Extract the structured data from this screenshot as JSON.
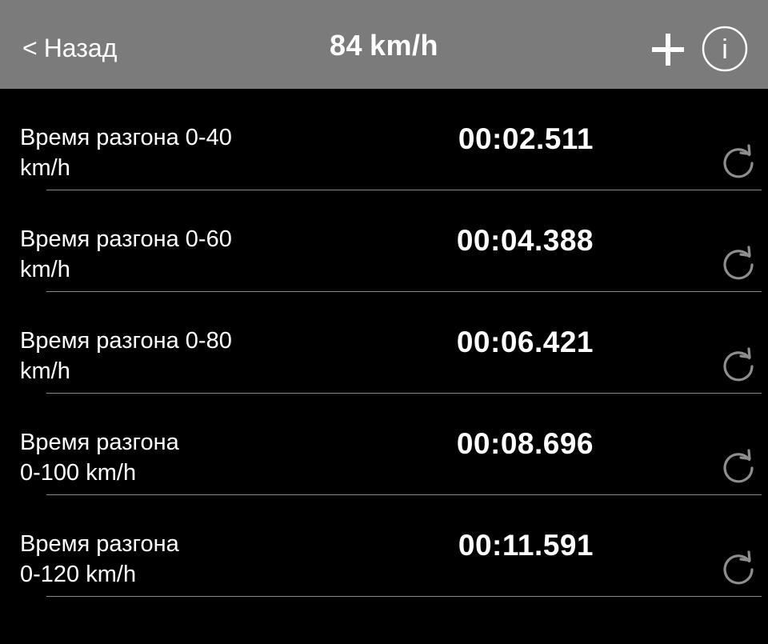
{
  "nav": {
    "back_chevron": "<",
    "back_label": "Назад",
    "title_speed": "84",
    "title_unit": "km/h",
    "add_icon": "plus-icon",
    "info_icon": "info-icon",
    "info_glyph": "i",
    "bar_color": "#7b7b7b"
  },
  "rows": [
    {
      "label": "Время разгона  0-40\nkm/h",
      "time": "00:02.511",
      "icon": "refresh-icon"
    },
    {
      "label": "Время разгона  0-60\nkm/h",
      "time": "00:04.388",
      "icon": "refresh-icon"
    },
    {
      "label": "Время разгона  0-80\nkm/h",
      "time": "00:06.421",
      "icon": "refresh-icon"
    },
    {
      "label": "Время разгона\n0-100 km/h",
      "time": "00:08.696",
      "icon": "refresh-icon"
    },
    {
      "label": "Время разгона\n0-120 km/h",
      "time": "00:11.591",
      "icon": "refresh-icon"
    }
  ],
  "colors": {
    "background": "#000000",
    "text": "#ffffff",
    "icon_muted": "#8e8e8e",
    "divider": "#8a8a8a"
  }
}
